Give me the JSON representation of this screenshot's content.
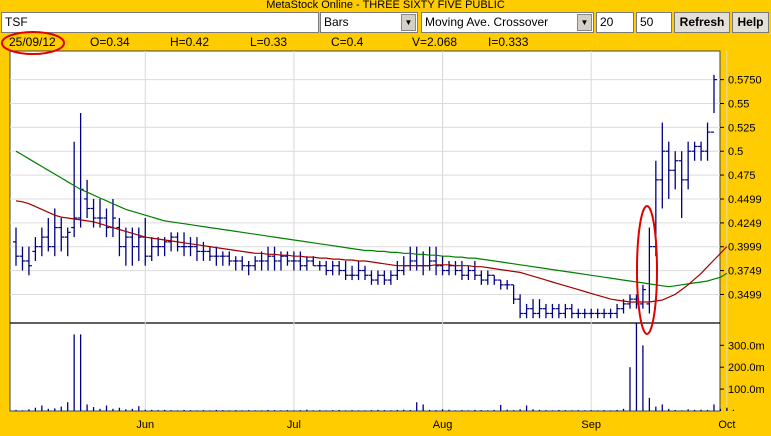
{
  "window": {
    "title": "MetaStock Online - THREE SIXTY FIVE PUBLIC"
  },
  "toolbar": {
    "symbol": "TSF",
    "chart_type": "Bars",
    "indicator": "Moving Ave. Crossover",
    "period_1": "20",
    "period_2": "50",
    "refresh_label": "Refresh",
    "help_label": "Help"
  },
  "readout": {
    "date": "25/09/12",
    "open": "O=0.34",
    "high": "H=0.42",
    "low": "L=0.33",
    "close": "C=0.4",
    "volume": "V=2.068",
    "interest": "I=0.333"
  },
  "colors": {
    "background": "#ffcc00",
    "bars": "#000080",
    "ma_fast": "#a00000",
    "ma_slow": "#008000",
    "highlight": "#e00000"
  },
  "chart_data": {
    "type": "bar",
    "price_axis": {
      "ticks": [
        "0.5750",
        "0.55",
        "0.525",
        "0.5",
        "0.475",
        "0.4499",
        "0.4249",
        "0.3999",
        "0.3749",
        "0.3499"
      ],
      "range": [
        0.32,
        0.605
      ]
    },
    "volume_axis": {
      "ticks": [
        "300.0m",
        "200.0m",
        "100.0m"
      ],
      "range": [
        0,
        370
      ]
    },
    "x_labels": [
      {
        "label": "Jun",
        "index": 20
      },
      {
        "label": "Jul",
        "index": 43
      },
      {
        "label": "Aug",
        "index": 66
      },
      {
        "label": "Sep",
        "index": 89
      },
      {
        "label": "Oct",
        "index": 110
      }
    ],
    "series": [
      {
        "name": "Price bars",
        "ohlc": [
          [
            0.405,
            0.42,
            0.38,
            0.39
          ],
          [
            0.39,
            0.4,
            0.375,
            0.385
          ],
          [
            0.385,
            0.4,
            0.37,
            0.38
          ],
          [
            0.395,
            0.41,
            0.385,
            0.4
          ],
          [
            0.4,
            0.42,
            0.39,
            0.41
          ],
          [
            0.41,
            0.43,
            0.395,
            0.4
          ],
          [
            0.4,
            0.44,
            0.39,
            0.42
          ],
          [
            0.42,
            0.43,
            0.395,
            0.41
          ],
          [
            0.41,
            0.42,
            0.39,
            0.415
          ],
          [
            0.42,
            0.51,
            0.41,
            0.43
          ],
          [
            0.43,
            0.54,
            0.42,
            0.46
          ],
          [
            0.45,
            0.47,
            0.43,
            0.44
          ],
          [
            0.44,
            0.45,
            0.42,
            0.43
          ],
          [
            0.43,
            0.45,
            0.42,
            0.43
          ],
          [
            0.43,
            0.44,
            0.41,
            0.42
          ],
          [
            0.42,
            0.45,
            0.41,
            0.43
          ],
          [
            0.42,
            0.43,
            0.39,
            0.4
          ],
          [
            0.4,
            0.42,
            0.38,
            0.41
          ],
          [
            0.41,
            0.42,
            0.38,
            0.4
          ],
          [
            0.4,
            0.42,
            0.385,
            0.41
          ],
          [
            0.41,
            0.43,
            0.38,
            0.39
          ],
          [
            0.39,
            0.41,
            0.385,
            0.4
          ],
          [
            0.4,
            0.41,
            0.39,
            0.4
          ],
          [
            0.4,
            0.41,
            0.39,
            0.405
          ],
          [
            0.405,
            0.415,
            0.395,
            0.41
          ],
          [
            0.41,
            0.415,
            0.395,
            0.4
          ],
          [
            0.4,
            0.415,
            0.39,
            0.4
          ],
          [
            0.4,
            0.41,
            0.39,
            0.4
          ],
          [
            0.4,
            0.41,
            0.385,
            0.395
          ],
          [
            0.395,
            0.405,
            0.385,
            0.395
          ],
          [
            0.395,
            0.4,
            0.385,
            0.39
          ],
          [
            0.39,
            0.4,
            0.38,
            0.39
          ],
          [
            0.39,
            0.395,
            0.38,
            0.39
          ],
          [
            0.39,
            0.395,
            0.38,
            0.385
          ],
          [
            0.385,
            0.39,
            0.375,
            0.385
          ],
          [
            0.385,
            0.39,
            0.375,
            0.38
          ],
          [
            0.38,
            0.385,
            0.37,
            0.38
          ],
          [
            0.38,
            0.39,
            0.375,
            0.385
          ],
          [
            0.385,
            0.395,
            0.375,
            0.385
          ],
          [
            0.385,
            0.4,
            0.375,
            0.39
          ],
          [
            0.39,
            0.4,
            0.375,
            0.385
          ],
          [
            0.385,
            0.395,
            0.375,
            0.39
          ],
          [
            0.39,
            0.395,
            0.38,
            0.385
          ],
          [
            0.385,
            0.395,
            0.375,
            0.385
          ],
          [
            0.385,
            0.395,
            0.375,
            0.38
          ],
          [
            0.38,
            0.39,
            0.375,
            0.385
          ],
          [
            0.385,
            0.39,
            0.38,
            0.38
          ],
          [
            0.38,
            0.385,
            0.375,
            0.38
          ],
          [
            0.38,
            0.385,
            0.37,
            0.375
          ],
          [
            0.375,
            0.385,
            0.37,
            0.38
          ],
          [
            0.38,
            0.385,
            0.37,
            0.375
          ],
          [
            0.375,
            0.385,
            0.365,
            0.37
          ],
          [
            0.37,
            0.38,
            0.365,
            0.37
          ],
          [
            0.37,
            0.385,
            0.365,
            0.375
          ],
          [
            0.375,
            0.38,
            0.365,
            0.37
          ],
          [
            0.37,
            0.375,
            0.36,
            0.365
          ],
          [
            0.365,
            0.375,
            0.36,
            0.37
          ],
          [
            0.37,
            0.375,
            0.36,
            0.365
          ],
          [
            0.365,
            0.375,
            0.36,
            0.37
          ],
          [
            0.37,
            0.385,
            0.365,
            0.375
          ],
          [
            0.375,
            0.39,
            0.37,
            0.38
          ],
          [
            0.38,
            0.4,
            0.375,
            0.385
          ],
          [
            0.385,
            0.4,
            0.375,
            0.38
          ],
          [
            0.38,
            0.395,
            0.37,
            0.38
          ],
          [
            0.38,
            0.4,
            0.375,
            0.385
          ],
          [
            0.385,
            0.4,
            0.37,
            0.38
          ],
          [
            0.38,
            0.39,
            0.37,
            0.375
          ],
          [
            0.375,
            0.385,
            0.37,
            0.38
          ],
          [
            0.38,
            0.385,
            0.37,
            0.375
          ],
          [
            0.375,
            0.385,
            0.365,
            0.37
          ],
          [
            0.37,
            0.38,
            0.365,
            0.375
          ],
          [
            0.375,
            0.385,
            0.365,
            0.37
          ],
          [
            0.37,
            0.375,
            0.36,
            0.365
          ],
          [
            0.365,
            0.375,
            0.36,
            0.37
          ],
          [
            0.37,
            0.37,
            0.36,
            0.365
          ],
          [
            0.365,
            0.365,
            0.355,
            0.36
          ],
          [
            0.36,
            0.365,
            0.355,
            0.36
          ],
          [
            0.36,
            0.36,
            0.34,
            0.345
          ],
          [
            0.345,
            0.35,
            0.325,
            0.33
          ],
          [
            0.33,
            0.34,
            0.325,
            0.335
          ],
          [
            0.335,
            0.345,
            0.325,
            0.33
          ],
          [
            0.33,
            0.345,
            0.325,
            0.335
          ],
          [
            0.335,
            0.34,
            0.325,
            0.33
          ],
          [
            0.33,
            0.34,
            0.325,
            0.335
          ],
          [
            0.335,
            0.34,
            0.325,
            0.33
          ],
          [
            0.33,
            0.34,
            0.325,
            0.335
          ],
          [
            0.335,
            0.34,
            0.325,
            0.33
          ],
          [
            0.33,
            0.335,
            0.325,
            0.33
          ],
          [
            0.33,
            0.335,
            0.325,
            0.33
          ],
          [
            0.33,
            0.335,
            0.325,
            0.33
          ],
          [
            0.33,
            0.335,
            0.325,
            0.33
          ],
          [
            0.33,
            0.335,
            0.325,
            0.33
          ],
          [
            0.33,
            0.335,
            0.325,
            0.33
          ],
          [
            0.33,
            0.34,
            0.325,
            0.335
          ],
          [
            0.335,
            0.345,
            0.33,
            0.34
          ],
          [
            0.34,
            0.35,
            0.335,
            0.345
          ],
          [
            0.345,
            0.35,
            0.335,
            0.34
          ],
          [
            0.34,
            0.36,
            0.335,
            0.355
          ],
          [
            0.34,
            0.42,
            0.33,
            0.4
          ],
          [
            0.4,
            0.49,
            0.39,
            0.47
          ],
          [
            0.47,
            0.53,
            0.44,
            0.5
          ],
          [
            0.5,
            0.51,
            0.45,
            0.48
          ],
          [
            0.48,
            0.5,
            0.46,
            0.49
          ],
          [
            0.49,
            0.5,
            0.43,
            0.47
          ],
          [
            0.47,
            0.51,
            0.46,
            0.5
          ],
          [
            0.5,
            0.51,
            0.49,
            0.505
          ],
          [
            0.505,
            0.51,
            0.49,
            0.5
          ],
          [
            0.5,
            0.53,
            0.49,
            0.52
          ],
          [
            0.52,
            0.58,
            0.54,
            0.575
          ]
        ]
      },
      {
        "name": "MA 20",
        "values": [
          0.448,
          0.447,
          0.445,
          0.442,
          0.439,
          0.436,
          0.433,
          0.431,
          0.43,
          0.429,
          0.428,
          0.427,
          0.426,
          0.424,
          0.422,
          0.42,
          0.418,
          0.416,
          0.414,
          0.412,
          0.41,
          0.409,
          0.408,
          0.407,
          0.406,
          0.405,
          0.404,
          0.403,
          0.402,
          0.401,
          0.4,
          0.399,
          0.398,
          0.397,
          0.396,
          0.395,
          0.394,
          0.393,
          0.393,
          0.392,
          0.392,
          0.391,
          0.391,
          0.39,
          0.39,
          0.389,
          0.389,
          0.388,
          0.388,
          0.387,
          0.387,
          0.386,
          0.386,
          0.385,
          0.385,
          0.384,
          0.383,
          0.382,
          0.381,
          0.38,
          0.38,
          0.38,
          0.38,
          0.38,
          0.38,
          0.381,
          0.381,
          0.381,
          0.38,
          0.38,
          0.38,
          0.379,
          0.379,
          0.378,
          0.377,
          0.376,
          0.375,
          0.374,
          0.373,
          0.371,
          0.369,
          0.367,
          0.365,
          0.363,
          0.361,
          0.359,
          0.357,
          0.355,
          0.353,
          0.351,
          0.349,
          0.347,
          0.345,
          0.344,
          0.343,
          0.342,
          0.342,
          0.342,
          0.342,
          0.343,
          0.344,
          0.347,
          0.35,
          0.355,
          0.36,
          0.366,
          0.372,
          0.379,
          0.386,
          0.393,
          0.4
        ]
      },
      {
        "name": "MA 50",
        "values": [
          0.5,
          0.496,
          0.492,
          0.488,
          0.484,
          0.48,
          0.476,
          0.472,
          0.468,
          0.464,
          0.46,
          0.457,
          0.454,
          0.451,
          0.448,
          0.445,
          0.442,
          0.439,
          0.437,
          0.435,
          0.433,
          0.431,
          0.429,
          0.427,
          0.426,
          0.425,
          0.424,
          0.423,
          0.422,
          0.421,
          0.42,
          0.419,
          0.418,
          0.417,
          0.416,
          0.415,
          0.414,
          0.413,
          0.412,
          0.411,
          0.41,
          0.409,
          0.408,
          0.407,
          0.406,
          0.405,
          0.404,
          0.403,
          0.402,
          0.401,
          0.4,
          0.399,
          0.398,
          0.397,
          0.396,
          0.396,
          0.395,
          0.395,
          0.394,
          0.394,
          0.393,
          0.393,
          0.392,
          0.392,
          0.391,
          0.391,
          0.39,
          0.39,
          0.389,
          0.389,
          0.388,
          0.388,
          0.387,
          0.386,
          0.385,
          0.384,
          0.383,
          0.382,
          0.381,
          0.38,
          0.379,
          0.378,
          0.377,
          0.376,
          0.375,
          0.374,
          0.373,
          0.372,
          0.371,
          0.37,
          0.369,
          0.368,
          0.367,
          0.366,
          0.365,
          0.364,
          0.363,
          0.362,
          0.361,
          0.36,
          0.359,
          0.358,
          0.359,
          0.36,
          0.361,
          0.362,
          0.363,
          0.364,
          0.366,
          0.368,
          0.372
        ]
      },
      {
        "name": "Volume",
        "values": [
          5,
          3,
          8,
          15,
          25,
          10,
          12,
          20,
          40,
          350,
          350,
          30,
          18,
          10,
          25,
          10,
          15,
          8,
          10,
          22,
          6,
          5,
          4,
          5,
          4,
          3,
          5,
          4,
          3,
          4,
          3,
          5,
          4,
          3,
          4,
          3,
          4,
          3,
          3,
          5,
          4,
          3,
          4,
          3,
          4,
          6,
          3,
          4,
          3,
          4,
          5,
          3,
          4,
          3,
          3,
          4,
          5,
          4,
          3,
          5,
          6,
          5,
          40,
          30,
          5,
          4,
          8,
          6,
          3,
          4,
          3,
          5,
          4,
          3,
          5,
          28,
          6,
          4,
          8,
          25,
          8,
          5,
          4,
          3,
          5,
          4,
          3,
          4,
          3,
          4,
          3,
          4,
          3,
          5,
          10,
          200,
          400,
          300,
          60,
          20,
          30,
          10,
          5,
          3,
          8,
          5,
          6,
          5,
          30,
          10,
          15,
          5
        ]
      }
    ],
    "annotations": [
      {
        "type": "ellipse",
        "target": "date readout 25/09/12"
      },
      {
        "type": "ellipse",
        "target": "price bars around 25/09/12"
      }
    ]
  }
}
